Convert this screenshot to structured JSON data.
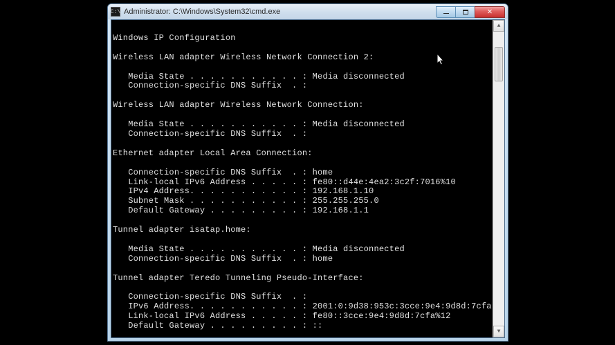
{
  "window": {
    "title": "Administrator: C:\\Windows\\System32\\cmd.exe"
  },
  "output": {
    "header": "Windows IP Configuration",
    "adapters": [
      {
        "name": "Wireless LAN adapter Wireless Network Connection 2:",
        "fields": [
          {
            "label": "   Media State . . . . . . . . . . . :",
            "value": " Media disconnected"
          },
          {
            "label": "   Connection-specific DNS Suffix  . :",
            "value": ""
          }
        ]
      },
      {
        "name": "Wireless LAN adapter Wireless Network Connection:",
        "fields": [
          {
            "label": "   Media State . . . . . . . . . . . :",
            "value": " Media disconnected"
          },
          {
            "label": "   Connection-specific DNS Suffix  . :",
            "value": ""
          }
        ]
      },
      {
        "name": "Ethernet adapter Local Area Connection:",
        "fields": [
          {
            "label": "   Connection-specific DNS Suffix  . :",
            "value": " home"
          },
          {
            "label": "   Link-local IPv6 Address . . . . . :",
            "value": " fe80::d44e:4ea2:3c2f:7016%10"
          },
          {
            "label": "   IPv4 Address. . . . . . . . . . . :",
            "value": " 192.168.1.10"
          },
          {
            "label": "   Subnet Mask . . . . . . . . . . . :",
            "value": " 255.255.255.0"
          },
          {
            "label": "   Default Gateway . . . . . . . . . :",
            "value": " 192.168.1.1"
          }
        ]
      },
      {
        "name": "Tunnel adapter isatap.home:",
        "fields": [
          {
            "label": "   Media State . . . . . . . . . . . :",
            "value": " Media disconnected"
          },
          {
            "label": "   Connection-specific DNS Suffix  . :",
            "value": " home"
          }
        ]
      },
      {
        "name": "Tunnel adapter Teredo Tunneling Pseudo-Interface:",
        "fields": [
          {
            "label": "   Connection-specific DNS Suffix  . :",
            "value": ""
          },
          {
            "label": "   IPv6 Address. . . . . . . . . . . :",
            "value": " 2001:0:9d38:953c:3cce:9e4:9d8d:7cfa"
          },
          {
            "label": "   Link-local IPv6 Address . . . . . :",
            "value": " fe80::3cce:9e4:9d8d:7cfa%12"
          },
          {
            "label": "   Default Gateway . . . . . . . . . :",
            "value": " ::"
          }
        ]
      }
    ]
  }
}
